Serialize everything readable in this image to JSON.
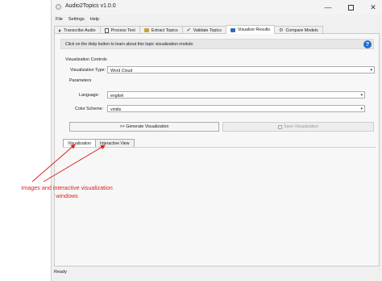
{
  "window": {
    "title": "Audio2Topics v1.0.0",
    "controls": {
      "minimize": "—",
      "close": "✕"
    }
  },
  "menu": {
    "items": [
      "File",
      "Settings",
      "Help"
    ]
  },
  "tabs": [
    {
      "label": "Transcribe Audio",
      "icon": "speaker-icon"
    },
    {
      "label": "Process Text",
      "icon": "document-icon"
    },
    {
      "label": "Extract Topics",
      "icon": "folder-icon"
    },
    {
      "label": "Validate Topics",
      "icon": "check-icon"
    },
    {
      "label": "Visualize Results",
      "icon": "screen-icon",
      "active": true
    },
    {
      "label": "Compare Models",
      "icon": "gear-icon"
    }
  ],
  "help": {
    "text": "Click on the Help button to learn about this topic visualization module.",
    "button": "?"
  },
  "controls": {
    "section_label": "Visualization Controls",
    "type_label": "Visualization Type:",
    "type_value": "Word Cloud",
    "parameters_label": "Parameters",
    "language_label": "Language:",
    "language_value": "english",
    "color_label": "Color Scheme:",
    "color_value": "viridis",
    "caret": "▾",
    "generate_button": ">> Generate Visualization",
    "save_button": "Save Visualization"
  },
  "result_tabs": [
    {
      "label": "Visualization",
      "active": true
    },
    {
      "label": "Interactive View"
    }
  ],
  "status": "Ready",
  "annotation": "Images and interactive visualization windows",
  "colors": {
    "accent": "#1f6fd1",
    "annotation": "#e02020"
  }
}
